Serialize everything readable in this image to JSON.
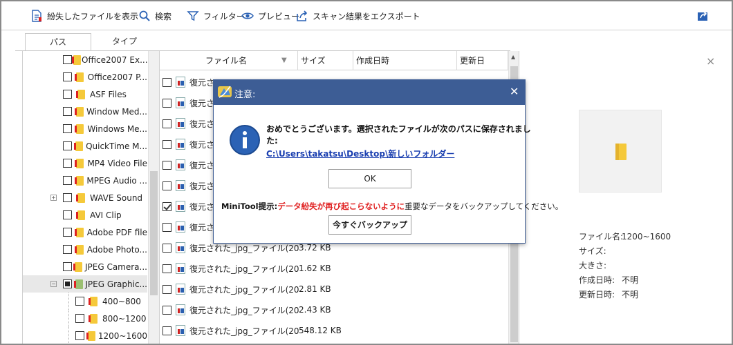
{
  "toolbar": {
    "lost_files": "紛失したファイルを表示",
    "search": "検索",
    "filter": "フィルター",
    "preview": "プレビュー",
    "export": "スキャン結果をエクスポート"
  },
  "tabs": [
    "パス",
    "タイプ"
  ],
  "tree": [
    {
      "label": "Office2007 Ex...",
      "state": "unchecked"
    },
    {
      "label": "Office2007 P...",
      "state": "unchecked"
    },
    {
      "label": "ASF Files",
      "state": "unchecked"
    },
    {
      "label": "Window Med...",
      "state": "unchecked"
    },
    {
      "label": "Windows Me...",
      "state": "unchecked"
    },
    {
      "label": "QuickTime M...",
      "state": "unchecked"
    },
    {
      "label": "MP4 Video File",
      "state": "unchecked"
    },
    {
      "label": "MPEG Audio ...",
      "state": "unchecked"
    },
    {
      "label": "WAVE Sound",
      "state": "unchecked",
      "expander": "+"
    },
    {
      "label": "AVI Clip",
      "state": "unchecked"
    },
    {
      "label": "Adobe PDF file",
      "state": "unchecked"
    },
    {
      "label": "Adobe Photo...",
      "state": "unchecked"
    },
    {
      "label": "JPEG Camera...",
      "state": "unchecked"
    },
    {
      "label": "JPEG Graphic...",
      "state": "partial",
      "expander": "−",
      "selected": true
    },
    {
      "label": "400~800",
      "state": "unchecked",
      "child": true
    },
    {
      "label": "800~1200",
      "state": "unchecked",
      "child": true
    },
    {
      "label": "1200~1600",
      "state": "unchecked",
      "child": true
    }
  ],
  "file_columns": [
    "ファイル名",
    "サイズ",
    "作成日時",
    "更新日"
  ],
  "files": [
    {
      "name": "復元さ",
      "size": "",
      "checked": false
    },
    {
      "name": "復元さ",
      "size": "",
      "checked": false
    },
    {
      "name": "復元さ",
      "size": "",
      "checked": false
    },
    {
      "name": "復元さ",
      "size": "",
      "checked": false
    },
    {
      "name": "復元さ",
      "size": "",
      "checked": false
    },
    {
      "name": "復元さ",
      "size": "",
      "checked": false
    },
    {
      "name": "復元さ",
      "size": "",
      "checked": true
    },
    {
      "name": "復元さ",
      "size": "",
      "checked": false
    },
    {
      "name": "復元された_jpg_ファイル(200)...",
      "size": "3.72 KB",
      "checked": false
    },
    {
      "name": "復元された_jpg_ファイル(201)...",
      "size": "1.62 KB",
      "checked": false
    },
    {
      "name": "復元された_jpg_ファイル(202)...",
      "size": "2.81 KB",
      "checked": false
    },
    {
      "name": "復元された_jpg_ファイル(203)...",
      "size": "2.43 KB",
      "checked": false
    },
    {
      "name": "復元された_jpg_ファイル(204)...",
      "size": "548.12 KB",
      "checked": false
    }
  ],
  "preview": {
    "close": "×",
    "props": [
      {
        "label": "ファイル名:",
        "value": "1200~1600"
      },
      {
        "label": "サイズ:",
        "value": ""
      },
      {
        "label": "大きさ:",
        "value": ""
      },
      {
        "label": "作成日時:",
        "value": "不明"
      },
      {
        "label": "更新日時:",
        "value": "不明"
      }
    ]
  },
  "dialog": {
    "title": "注意:",
    "close": "✕",
    "message_line1": "おめでとうございます。選択されたファイルが次のパスに保存されまし",
    "message_line2": "た:",
    "path_link": "C:\\Users\\takatsu\\Desktop\\新しいフォルダー",
    "ok": "OK",
    "tip_prefix": "MiniTool提示:",
    "tip_red": "データ紛失が再び起こらないように",
    "tip_suffix": "重要なデータをバックアップしてください。",
    "backup": "今すぐバックアップ"
  },
  "colors": {
    "dialog_title_bg": "#3d5d95",
    "link": "#1a3fb0",
    "tip_red": "#e02020",
    "info_icon": "#2b62b5"
  }
}
